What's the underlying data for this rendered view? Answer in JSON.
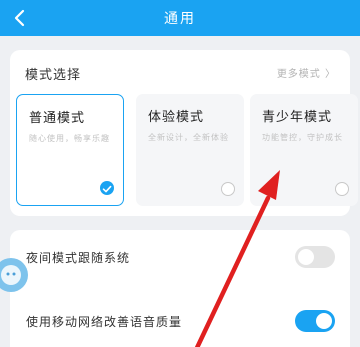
{
  "header": {
    "title": "通用"
  },
  "mode_card": {
    "title": "模式选择",
    "more": "更多模式 〉",
    "modes": [
      {
        "name": "普通模式",
        "desc": "随心使用，畅享乐趣",
        "selected": true
      },
      {
        "name": "体验模式",
        "desc": "全新设计，全新体验",
        "selected": false
      },
      {
        "name": "青少年模式",
        "desc": "功能管控，守护成长",
        "selected": false
      }
    ]
  },
  "settings": {
    "night_mode": {
      "label": "夜间模式跟随系统",
      "enabled": false
    },
    "mobile_network": {
      "label": "使用移动网络改善语音质量",
      "enabled": true
    }
  },
  "icons": {
    "back": "chevron-left-icon",
    "check": "checkmark-icon",
    "arrow": "red-arrow-annotation",
    "floating": "floating-assistant-icon"
  },
  "colors": {
    "accent": "#1aa3f2",
    "arrow": "#e02020"
  }
}
